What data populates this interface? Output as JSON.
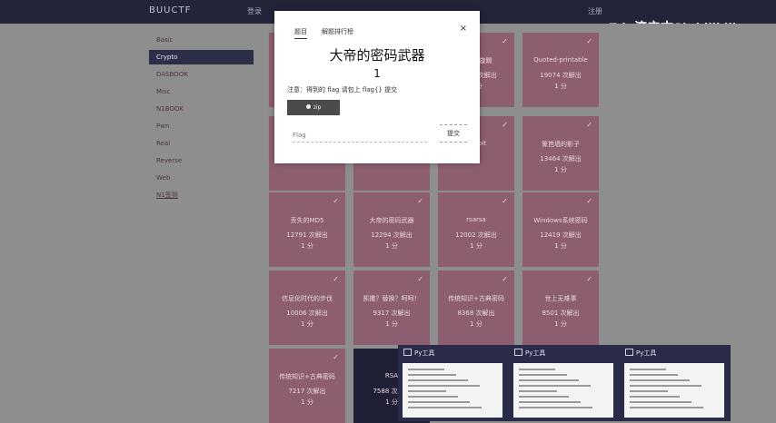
{
  "topbar": {
    "brand": "BUUCTF",
    "links": [
      "登录",
      "注册"
    ]
  },
  "watermark": {
    "text": "Edu济宁古Sir bilibili"
  },
  "sidebar": {
    "items": [
      {
        "label": "Basic"
      },
      {
        "label": "Crypto",
        "active": true
      },
      {
        "label": "DASBOOK"
      },
      {
        "label": "Misc"
      },
      {
        "label": "N1BOOK"
      },
      {
        "label": "Pwn"
      },
      {
        "label": "Real"
      },
      {
        "label": "Reverse"
      },
      {
        "label": "Web"
      },
      {
        "label": "N1签到"
      }
    ]
  },
  "grid": {
    "rows": [
      [
        {
          "name": "",
          "solves": "",
          "score": "",
          "solved": true
        },
        {
          "name": "",
          "solves": "",
          "score": "",
          "solved": true
        },
        {
          "name": "看我回旋踢",
          "solves": "24982 次解出",
          "score": "1 分",
          "solved": true
        },
        {
          "name": "Quoted-printable",
          "solves": "19074 次解出",
          "score": "1 分",
          "solved": true
        }
      ],
      [
        {
          "name": "",
          "solves": "",
          "score": "",
          "solved": true
        },
        {
          "name": "",
          "solves": "",
          "score": "",
          "solved": true
        },
        {
          "name": "Rabbit",
          "solves": "",
          "score": "",
          "solved": true
        },
        {
          "name": "篱笆墙的影子",
          "solves": "13464 次解出",
          "score": "1 分",
          "solved": true
        }
      ],
      [
        {
          "name": "丢失的MD5",
          "solves": "12791 次解出",
          "score": "1 分",
          "solved": true
        },
        {
          "name": "大帝的密码武器",
          "solves": "12294 次解出",
          "score": "1 分",
          "solved": true
        },
        {
          "name": "rsarsa",
          "solves": "12002 次解出",
          "score": "1 分",
          "solved": true
        },
        {
          "name": "Windows系统密码",
          "solves": "12419 次解出",
          "score": "1 分",
          "solved": true
        }
      ],
      [
        {
          "name": "信息化时代的步伐",
          "solves": "10006 次解出",
          "score": "1 分",
          "solved": true
        },
        {
          "name": "凯撒？替换？呵呵！",
          "solves": "9317 次解出",
          "score": "1 分",
          "solved": true
        },
        {
          "name": "传统知识+古典密码",
          "solves": "8368 次解出",
          "score": "1 分",
          "solved": true
        },
        {
          "name": "世上无难事",
          "solves": "8501 次解出",
          "score": "1 分",
          "solved": true
        }
      ],
      [
        {
          "name": "传统知识+古典密码",
          "solves": "7217 次解出",
          "score": "1 分",
          "solved": true
        },
        {
          "name": "RSA",
          "solves": "7588 次解出",
          "score": "1 分",
          "solved": false
        }
      ]
    ]
  },
  "modal": {
    "tabs": [
      "题目",
      "解题排行榜"
    ],
    "close": "×",
    "title": "大帝的密码武器",
    "value": "1",
    "notice": "注意：得到的 flag 请包上 flag{} 提交",
    "file_button": "zip",
    "flag_placeholder": "Flag",
    "submit": "提交"
  },
  "taskbar": {
    "items": [
      {
        "title": "Py工具"
      },
      {
        "title": "Py工具"
      },
      {
        "title": "Py工具"
      }
    ]
  }
}
